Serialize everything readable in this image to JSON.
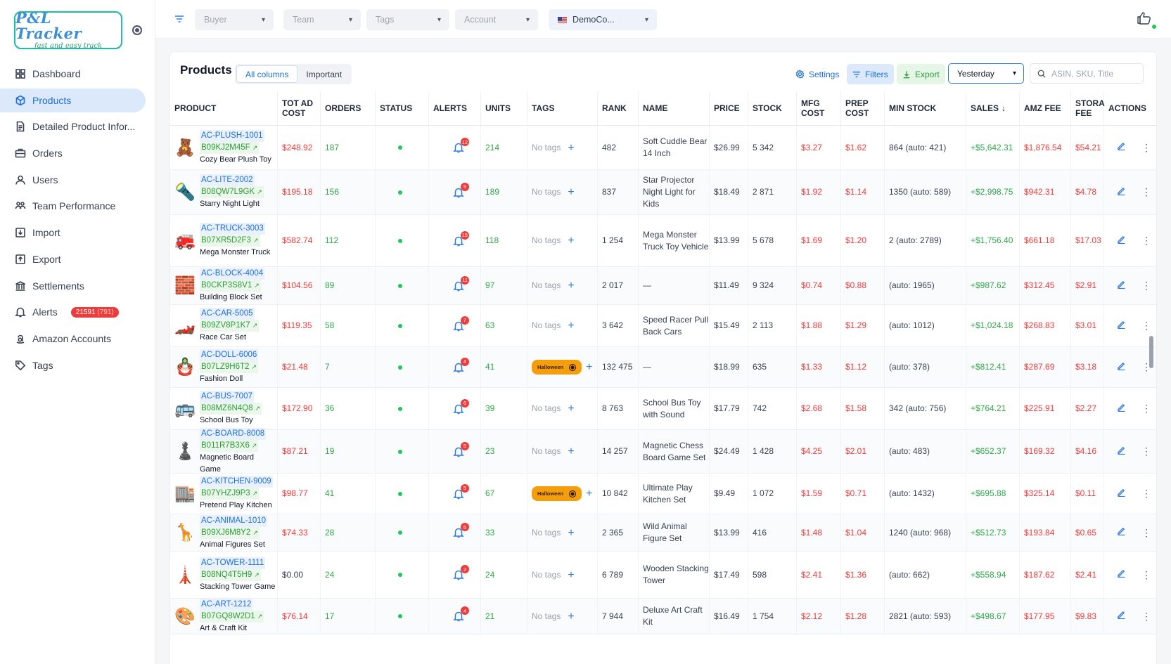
{
  "app": {
    "logo_title": "P&L Tracker",
    "logo_subtitle": "fast and easy track"
  },
  "sidebar": {
    "items": [
      {
        "label": "Dashboard",
        "icon": "dashboard-icon"
      },
      {
        "label": "Products",
        "icon": "box-icon",
        "active": true
      },
      {
        "label": "Detailed Product Infor...",
        "icon": "document-icon"
      },
      {
        "label": "Orders",
        "icon": "briefcase-icon"
      },
      {
        "label": "Users",
        "icon": "user-icon"
      },
      {
        "label": "Team Performance",
        "icon": "team-icon"
      },
      {
        "label": "Import",
        "icon": "import-icon"
      },
      {
        "label": "Export",
        "icon": "export-icon"
      },
      {
        "label": "Settlements",
        "icon": "bank-icon"
      },
      {
        "label": "Alerts",
        "icon": "bell-icon",
        "badge": "21591",
        "badge_sub": "(791)"
      },
      {
        "label": "Amazon Accounts",
        "icon": "amazon-icon"
      },
      {
        "label": "Tags",
        "icon": "tag-icon"
      }
    ]
  },
  "topbar": {
    "filters": {
      "buyer": "Buyer",
      "team": "Team",
      "tags": "Tags",
      "account": "Account",
      "marketplace": "DemoCo..."
    }
  },
  "panel": {
    "title": "Products",
    "view_tabs": [
      "All columns",
      "Important"
    ],
    "settings_label": "Settings",
    "filters_label": "Filters",
    "export_label": "Export",
    "period": "Yesterday",
    "search_placeholder": "ASIN, SKU, Title"
  },
  "table": {
    "columns": [
      "PRODUCT",
      "TOT AD COST",
      "ORDERS",
      "STATUS",
      "ALERTS",
      "UNITS",
      "TAGS",
      "RANK",
      "NAME",
      "PRICE",
      "STOCK",
      "MFG COST",
      "PREP COST",
      "MIN STOCK",
      "SALES",
      "AMZ FEE",
      "STORA FEE",
      "ACTIONS"
    ],
    "sort_column": "SALES",
    "no_tags_label": "No tags",
    "tag_label": "Halloween",
    "rows": [
      {
        "icon": "🧸",
        "sku": "AC-PLUSH-1001",
        "asin": "B09KJ2M45F",
        "title": "Cozy Bear Plush Toy",
        "ad_cost": "$248.92",
        "orders": "187",
        "alerts": "12",
        "units": "214",
        "tag": "",
        "rank": "482",
        "name": "Soft Cuddle Bear 14 Inch",
        "price": "$26.99",
        "stock": "5 342",
        "mfg": "$3.27",
        "prep": "$1.62",
        "min_stock": "864 (auto: 421)",
        "sales": "+$5,642.31",
        "amz_fee": "$1,876.54",
        "stora_fee": "$54.21"
      },
      {
        "icon": "🔦",
        "sku": "AC-LITE-2002",
        "asin": "B08QW7L9GK",
        "title": "Starry Night Light",
        "ad_cost": "$195.18",
        "orders": "156",
        "alerts": "9",
        "units": "189",
        "tag": "",
        "rank": "837",
        "name": "Star Projector Night Light for Kids",
        "price": "$18.49",
        "stock": "2 871",
        "mfg": "$1.92",
        "prep": "$1.14",
        "min_stock": "1350 (auto: 589)",
        "sales": "+$2,998.75",
        "amz_fee": "$942.31",
        "stora_fee": "$4.78"
      },
      {
        "icon": "🚒",
        "sku": "AC-TRUCK-3003",
        "asin": "B07XR5D2F3",
        "title": "Mega Monster Truck",
        "ad_cost": "$582.74",
        "orders": "112",
        "alerts": "15",
        "units": "118",
        "tag": "",
        "rank": "1 254",
        "name": "Mega Monster Truck Toy Vehicle",
        "price": "$13.99",
        "stock": "5 678",
        "mfg": "$1.69",
        "prep": "$1.20",
        "min_stock": "2 (auto: 2789)",
        "sales": "+$1,756.40",
        "amz_fee": "$661.18",
        "stora_fee": "$17.03"
      },
      {
        "icon": "🧱",
        "sku": "AC-BLOCK-4004",
        "asin": "B0CKP3S8V1",
        "title": "Building Block Set",
        "ad_cost": "$104.56",
        "orders": "89",
        "alerts": "11",
        "units": "97",
        "tag": "",
        "rank": "2 017",
        "name": "—",
        "price": "$11.49",
        "stock": "9 324",
        "mfg": "$0.74",
        "prep": "$0.88",
        "min_stock": "(auto: 1965)",
        "sales": "+$987.62",
        "amz_fee": "$312.45",
        "stora_fee": "$2.91"
      },
      {
        "icon": "🏎️",
        "sku": "AC-CAR-5005",
        "asin": "B09ZV8P1K7",
        "title": "Race Car Set",
        "ad_cost": "$119.35",
        "orders": "58",
        "alerts": "7",
        "units": "63",
        "tag": "",
        "rank": "3 642",
        "name": "Speed Racer Pull Back Cars",
        "price": "$15.49",
        "stock": "2 113",
        "mfg": "$1.88",
        "prep": "$1.29",
        "min_stock": "(auto: 1012)",
        "sales": "+$1,024.18",
        "amz_fee": "$268.83",
        "stora_fee": "$3.01"
      },
      {
        "icon": "🪆",
        "sku": "AC-DOLL-6006",
        "asin": "B07LZ9H6T2",
        "title": "Fashion Doll",
        "ad_cost": "$21.48",
        "orders": "7",
        "alerts": "4",
        "units": "41",
        "tag": "Halloween",
        "rank": "132 475",
        "name": "—",
        "price": "$18.99",
        "stock": "635",
        "mfg": "$1.33",
        "prep": "$1.12",
        "min_stock": "(auto: 378)",
        "sales": "+$812.41",
        "amz_fee": "$287.69",
        "stora_fee": "$3.18"
      },
      {
        "icon": "🚌",
        "sku": "AC-BUS-7007",
        "asin": "B08MZ6N4Q8",
        "title": "School Bus Toy",
        "ad_cost": "$172.90",
        "orders": "36",
        "alerts": "6",
        "units": "39",
        "tag": "",
        "rank": "8 763",
        "name": "School Bus Toy with Sound",
        "price": "$17.79",
        "stock": "742",
        "mfg": "$2.68",
        "prep": "$1.58",
        "min_stock": "342 (auto: 756)",
        "sales": "+$764.21",
        "amz_fee": "$225.91",
        "stora_fee": "$2.27"
      },
      {
        "icon": "♟️",
        "sku": "AC-BOARD-8008",
        "asin": "B011R7B3X6",
        "title": "Magnetic Board Game",
        "ad_cost": "$87.21",
        "orders": "19",
        "alerts": "5",
        "units": "23",
        "tag": "",
        "rank": "14 257",
        "name": "Magnetic Chess Board Game Set",
        "price": "$24.49",
        "stock": "1 428",
        "mfg": "$4.25",
        "prep": "$2.01",
        "min_stock": "(auto: 483)",
        "sales": "+$652.37",
        "amz_fee": "$169.32",
        "stora_fee": "$4.16"
      },
      {
        "icon": "🏬",
        "sku": "AC-KITCHEN-9009",
        "asin": "B07YHZJ9P3",
        "title": "Pretend Play Kitchen",
        "ad_cost": "$98.77",
        "orders": "41",
        "alerts": "5",
        "units": "67",
        "tag": "Halloween",
        "rank": "10 842",
        "name": "Ultimate Play Kitchen Set",
        "price": "$9.49",
        "stock": "1 072",
        "mfg": "$1.59",
        "prep": "$0.71",
        "min_stock": "(auto: 1432)",
        "sales": "+$695.88",
        "amz_fee": "$325.14",
        "stora_fee": "$0.11"
      },
      {
        "icon": "🦒",
        "sku": "AC-ANIMAL-1010",
        "asin": "B09XJ6M8Y2",
        "title": "Animal Figures Set",
        "ad_cost": "$74.33",
        "orders": "28",
        "alerts": "5",
        "units": "33",
        "tag": "",
        "rank": "2 365",
        "name": "Wild Animal Figure Set",
        "price": "$13.99",
        "stock": "416",
        "mfg": "$1.48",
        "prep": "$1.04",
        "min_stock": "1240 (auto: 968)",
        "sales": "+$512.73",
        "amz_fee": "$193.84",
        "stora_fee": "$0.65"
      },
      {
        "icon": "🗼",
        "sku": "AC-TOWER-1111",
        "asin": "B08NQ4T5H9",
        "title": "Stacking Tower Game",
        "ad_cost": "$0.00",
        "orders": "24",
        "alerts": "2",
        "units": "24",
        "tag": "",
        "rank": "6 789",
        "name": "Wooden Stacking Tower",
        "price": "$17.49",
        "stock": "598",
        "mfg": "$2.41",
        "prep": "$1.36",
        "min_stock": "(auto: 662)",
        "sales": "+$558.94",
        "amz_fee": "$187.62",
        "stora_fee": "$2.41"
      },
      {
        "icon": "🎨",
        "sku": "AC-ART-1212",
        "asin": "B07GQ8W2D1",
        "title": "Art & Craft Kit",
        "ad_cost": "$76.14",
        "orders": "17",
        "alerts": "4",
        "units": "21",
        "tag": "",
        "rank": "7 944",
        "name": "Deluxe Art Craft Kit",
        "price": "$16.49",
        "stock": "1 754",
        "mfg": "$2.12",
        "prep": "$1.28",
        "min_stock": "2821 (auto: 593)",
        "sales": "+$498.67",
        "amz_fee": "$177.95",
        "stora_fee": "$9.83"
      }
    ]
  },
  "colors": {
    "accent": "#2f7be5",
    "positive": "#2ea84a",
    "negative": "#ef3b3b",
    "tag": "#f59e0b"
  }
}
